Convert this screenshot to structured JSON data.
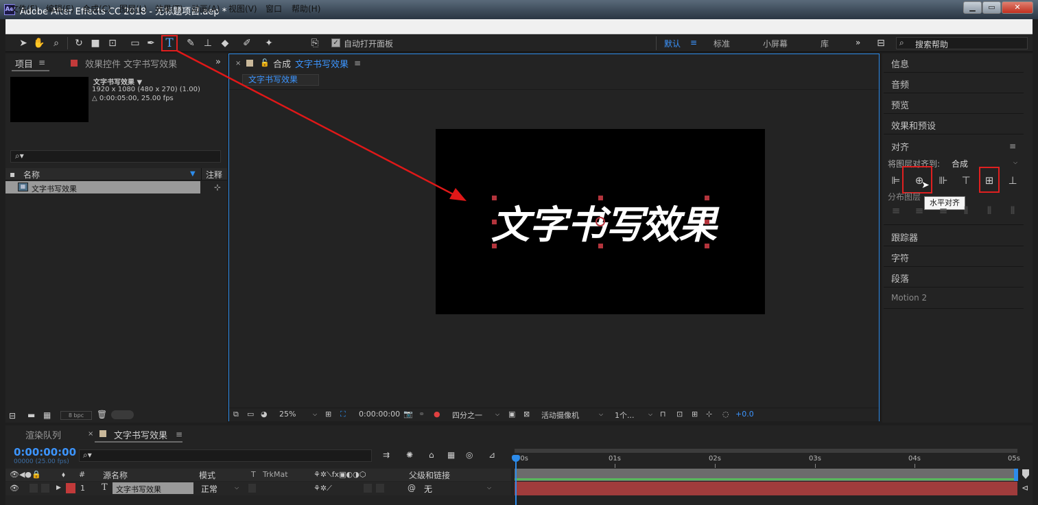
{
  "window": {
    "app_icon_text": "Ae",
    "title": "Adobe After Effects CC 2018 - 无标题项目.aep *",
    "min_glyph": "▁",
    "max_glyph": "▭",
    "close_glyph": "✕"
  },
  "menu": [
    "文件(F)",
    "编辑(E)",
    "合成(C)",
    "图层(L)",
    "效果(T)",
    "动画(A)",
    "视图(V)",
    "窗口",
    "帮助(H)"
  ],
  "toolbar": {
    "auto_open_panel": "自动打开面板",
    "auto_open_checked": true,
    "workspaces": [
      "默认",
      "标准",
      "小屏幕",
      "库"
    ],
    "active_workspace": "默认",
    "more": "»",
    "search_help": "搜索帮助"
  },
  "project_panel": {
    "tab_project": "项目",
    "tab_effects": "效果控件 文字书写效果",
    "comp_name": "文字书写效果 ▼",
    "comp_resolution": "1920 x 1080  (480 x 270) (1.00)",
    "comp_duration": "△ 0:00:05:00, 25.00 fps",
    "col_name": "名称",
    "col_comment": "注释",
    "items": [
      {
        "name": "文字书写效果"
      }
    ],
    "bpc": "8 bpc"
  },
  "viewer": {
    "tab_prefix": "合成",
    "tab_comp": "文字书写效果",
    "breadcrumb": "文字书写效果",
    "title_text": [
      "文",
      "字",
      "书",
      "写",
      "效",
      "果"
    ],
    "zoom": "25%",
    "timecode": "0:00:00:00",
    "resolution": "四分之一",
    "camera": "活动摄像机",
    "views": "1个...",
    "exposure": "+0.0"
  },
  "right_panels": {
    "info": "信息",
    "audio": "音频",
    "preview": "预览",
    "effects_presets": "效果和预设",
    "align": "对齐",
    "align_to_label": "将图层对齐到:",
    "align_to_value": "合成",
    "distribute_label": "分布图层",
    "tooltip": "水平对齐",
    "tracker": "跟踪器",
    "character": "字符",
    "paragraph": "段落",
    "motion2": "Motion 2"
  },
  "timeline": {
    "tab_render": "渲染队列",
    "tab_comp": "文字书写效果",
    "current_time": "0:00:00:00",
    "frame_info": "00000 (25.00 fps)",
    "col_source": "源名称",
    "col_mode": "模式",
    "col_t": "T",
    "col_trkmat": "TrkMat",
    "col_parent": "父级和链接",
    "col_number": "#",
    "ruler": [
      "00s",
      "01s",
      "02s",
      "03s",
      "04s",
      "05s"
    ],
    "layer": {
      "index": "1",
      "type_glyph": "T",
      "name": "文字书写效果",
      "mode": "正常",
      "parent": "无"
    }
  }
}
